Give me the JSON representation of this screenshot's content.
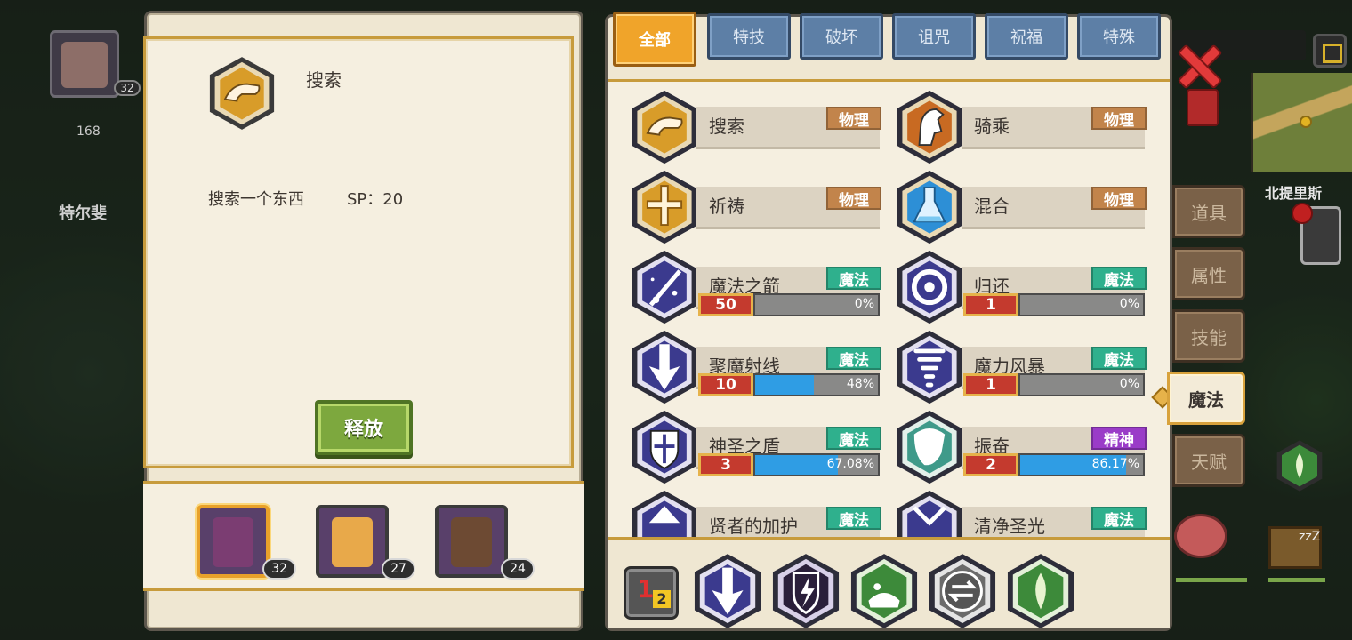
{
  "background": {
    "hero_level": "32",
    "stat_value": "168",
    "town_name": "特尔斐",
    "place_name": "北提里斯",
    "zzz": "zzZ"
  },
  "detail": {
    "skill_name": "搜索",
    "description": "搜索一个东西",
    "sp_text": "SP：20",
    "cast_button": "释放"
  },
  "party": [
    {
      "level": "32",
      "color": "#7b3d72"
    },
    {
      "level": "27",
      "color": "#e8a94a"
    },
    {
      "level": "24",
      "color": "#6d4a33"
    }
  ],
  "tabs": [
    "全部",
    "特技",
    "破坏",
    "诅咒",
    "祝福",
    "特殊"
  ],
  "active_tab": "全部",
  "skills": [
    {
      "name": "搜索",
      "tag": "物理",
      "tag_type": "phys",
      "icon": "hand-icon",
      "hex": "gold"
    },
    {
      "name": "骑乘",
      "tag": "物理",
      "tag_type": "phys",
      "icon": "horse-icon",
      "hex": "orange"
    },
    {
      "name": "祈祷",
      "tag": "物理",
      "tag_type": "phys",
      "icon": "holy-cross-icon",
      "hex": "gold"
    },
    {
      "name": "混合",
      "tag": "物理",
      "tag_type": "phys",
      "icon": "flask-icon",
      "hex": "blue"
    },
    {
      "name": "魔法之箭",
      "tag": "魔法",
      "tag_type": "magic",
      "icon": "magic-arrow-icon",
      "hex": "violet",
      "level": "50",
      "progress_pct": 0,
      "progress_text": "0%"
    },
    {
      "name": "归还",
      "tag": "魔法",
      "tag_type": "magic",
      "icon": "portal-icon",
      "hex": "violet",
      "level": "1",
      "progress_pct": 0,
      "progress_text": "0%"
    },
    {
      "name": "聚魔射线",
      "tag": "魔法",
      "tag_type": "magic",
      "icon": "beam-arrow-icon",
      "hex": "violet",
      "level": "10",
      "progress_pct": 48,
      "progress_text": "48%"
    },
    {
      "name": "魔力风暴",
      "tag": "魔法",
      "tag_type": "magic",
      "icon": "tornado-icon",
      "hex": "violet",
      "level": "1",
      "progress_pct": 0,
      "progress_text": "0%"
    },
    {
      "name": "神圣之盾",
      "tag": "魔法",
      "tag_type": "magic",
      "icon": "shield-icon",
      "hex": "violet",
      "level": "3",
      "progress_pct": 67.08,
      "progress_text": "67.08%"
    },
    {
      "name": "振奋",
      "tag": "精神",
      "tag_type": "spirit",
      "icon": "roar-icon",
      "hex": "teal",
      "level": "2",
      "progress_pct": 86.17,
      "progress_text": "86.17%"
    },
    {
      "name": "贤者的加护",
      "tag": "魔法",
      "tag_type": "magic",
      "icon": "sage-icon",
      "hex": "violet"
    },
    {
      "name": "清净圣光",
      "tag": "魔法",
      "tag_type": "magic",
      "icon": "holy-light-icon",
      "hex": "violet"
    }
  ],
  "hotbar": {
    "rank_one": "1",
    "rank_two": "2",
    "slots": [
      {
        "icon": "beam-arrow-icon",
        "hex": "violet"
      },
      {
        "icon": "lightning-shield-icon",
        "hex": "dark"
      },
      {
        "icon": "potion-icon",
        "hex": "green"
      },
      {
        "icon": "swap-icon",
        "hex": "gray"
      },
      {
        "icon": "leaf-icon",
        "hex": "green"
      }
    ]
  },
  "side_menu": [
    "道具",
    "属性",
    "技能",
    "魔法",
    "天赋"
  ],
  "side_active": "魔法",
  "colors": {
    "panel": "#efe7d2",
    "gold_border": "#c79b3c",
    "tab_blue": "#5d7fa6",
    "tab_active": "#f0a42a",
    "phys_tag": "#c2844b",
    "magic_tag": "#2fb08d",
    "spirit_tag": "#9a3cc8",
    "progress": "#2f9de4",
    "level_box": "#c43a2e"
  }
}
